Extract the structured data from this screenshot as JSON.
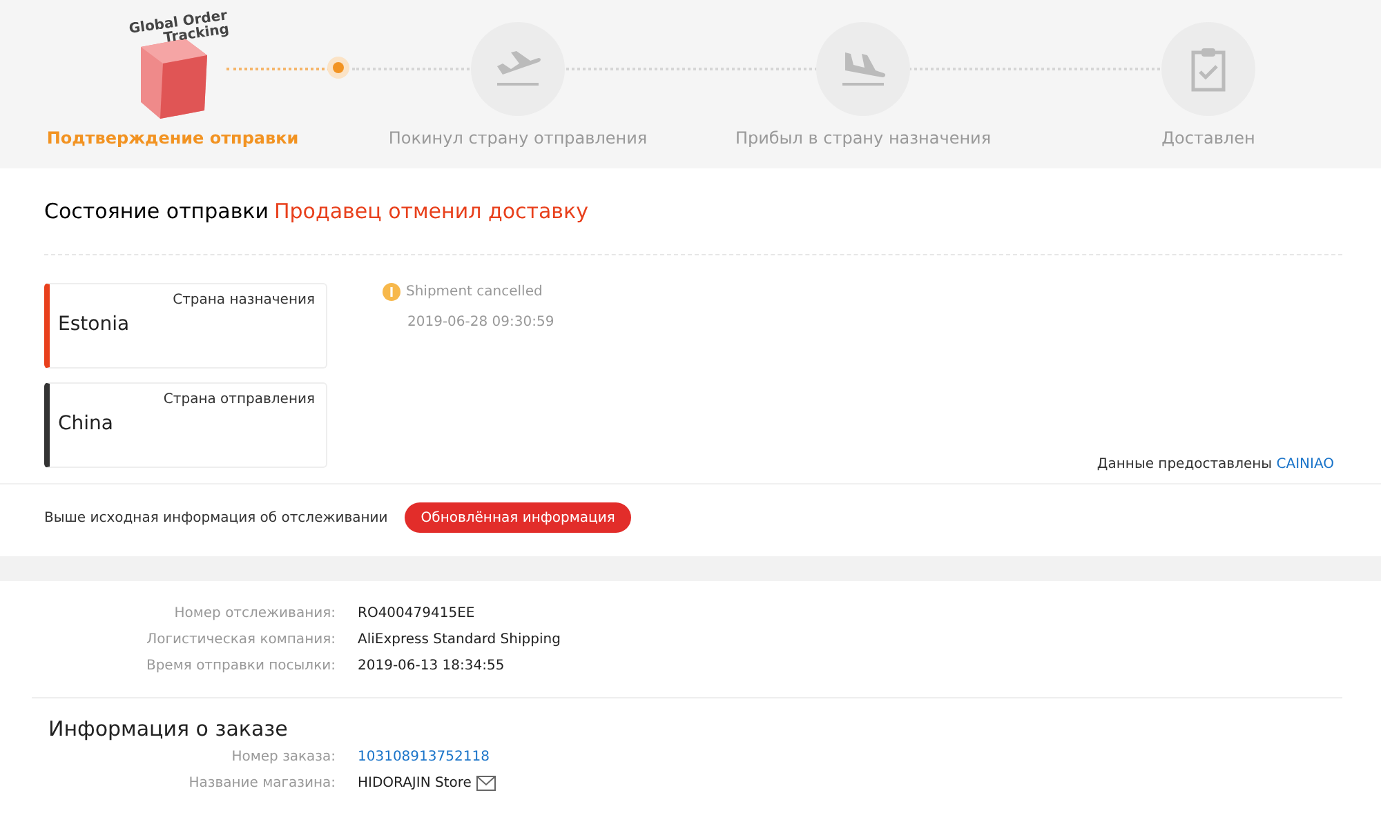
{
  "tracker": {
    "logo_text": [
      "Global Order",
      "Tracking"
    ],
    "steps": [
      {
        "kind": "logo",
        "label": "Подтверждение отправки",
        "active": true
      },
      {
        "kind": "departure",
        "label": "Покинул страну отправления",
        "active": false
      },
      {
        "kind": "arrival",
        "label": "Прибыл в страну назначения",
        "active": false
      },
      {
        "kind": "delivered",
        "label": "Доставлен",
        "active": false
      }
    ]
  },
  "status": {
    "label": "Состояние отправки",
    "value": "Продавец отменил доставку"
  },
  "countries": [
    {
      "caption": "Страна назначения",
      "name": "Estonia",
      "color": "#e8401c"
    },
    {
      "caption": "Страна отправления",
      "name": "China",
      "color": "#333333"
    }
  ],
  "events": [
    {
      "text": "Shipment cancelled",
      "time": "2019-06-28 09:30:59"
    }
  ],
  "provider": {
    "label": "Данные предоставлены",
    "link": "CAINIAO"
  },
  "original_info": {
    "text": "Выше исходная информация об отслеживании",
    "button": "Обновлённая информация"
  },
  "shipping": [
    {
      "label": "Номер отслеживания:",
      "value": "RO400479415EE"
    },
    {
      "label": "Логистическая компания:",
      "value": "AliExpress Standard Shipping"
    },
    {
      "label": "Время отправки посылки:",
      "value": "2019-06-13 18:34:55"
    }
  ],
  "order": {
    "title": "Информация о заказе",
    "rows": [
      {
        "label": "Номер заказа:",
        "value": "103108913752118",
        "kind": "link"
      },
      {
        "label": "Название магазина:",
        "value": "HIDORAJIN Store",
        "kind": "store"
      }
    ]
  }
}
